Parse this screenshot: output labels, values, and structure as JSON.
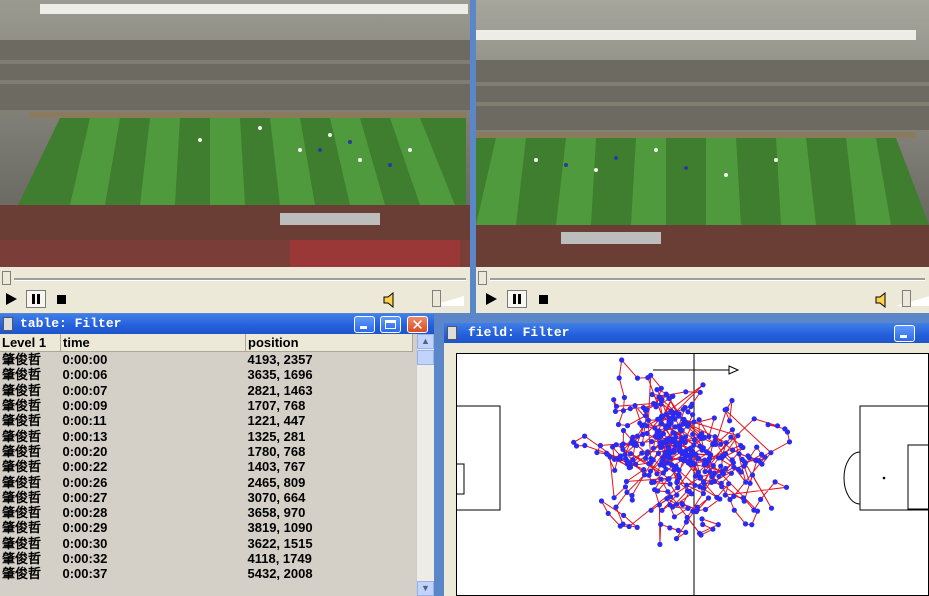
{
  "players": [
    {
      "id": "left"
    },
    {
      "id": "right"
    }
  ],
  "table_window": {
    "title": "table: Filter",
    "columns": [
      "Level 1",
      "time",
      "position"
    ],
    "rows": [
      [
        "肇俊哲",
        "0:00:00",
        "4193, 2357"
      ],
      [
        "肇俊哲",
        "0:00:06",
        "3635, 1696"
      ],
      [
        "肇俊哲",
        "0:00:07",
        "2821, 1463"
      ],
      [
        "肇俊哲",
        "0:00:09",
        "1707, 768"
      ],
      [
        "肇俊哲",
        "0:00:11",
        "1221, 447"
      ],
      [
        "肇俊哲",
        "0:00:13",
        "1325, 281"
      ],
      [
        "肇俊哲",
        "0:00:20",
        "1780, 768"
      ],
      [
        "肇俊哲",
        "0:00:22",
        "1403, 767"
      ],
      [
        "肇俊哲",
        "0:00:26",
        "2465, 809"
      ],
      [
        "肇俊哲",
        "0:00:27",
        "3070, 664"
      ],
      [
        "肇俊哲",
        "0:00:28",
        "3658, 970"
      ],
      [
        "肇俊哲",
        "0:00:29",
        "3819, 1090"
      ],
      [
        "肇俊哲",
        "0:00:30",
        "3622, 1515"
      ],
      [
        "肇俊哲",
        "0:00:32",
        "4118, 1749"
      ],
      [
        "肇俊哲",
        "0:00:37",
        "5432, 2008"
      ]
    ]
  },
  "field_window": {
    "title": "field: Filter"
  },
  "colors": {
    "track_line": "#e0141e",
    "track_point": "#2a2af0",
    "title_bar": "#245edb"
  },
  "icons": {
    "play": "play-icon",
    "pause": "pause-icon",
    "stop": "stop-icon",
    "volume": "speaker-icon",
    "minimize": "minimize-icon",
    "maximize": "maximize-icon",
    "close": "close-icon"
  }
}
